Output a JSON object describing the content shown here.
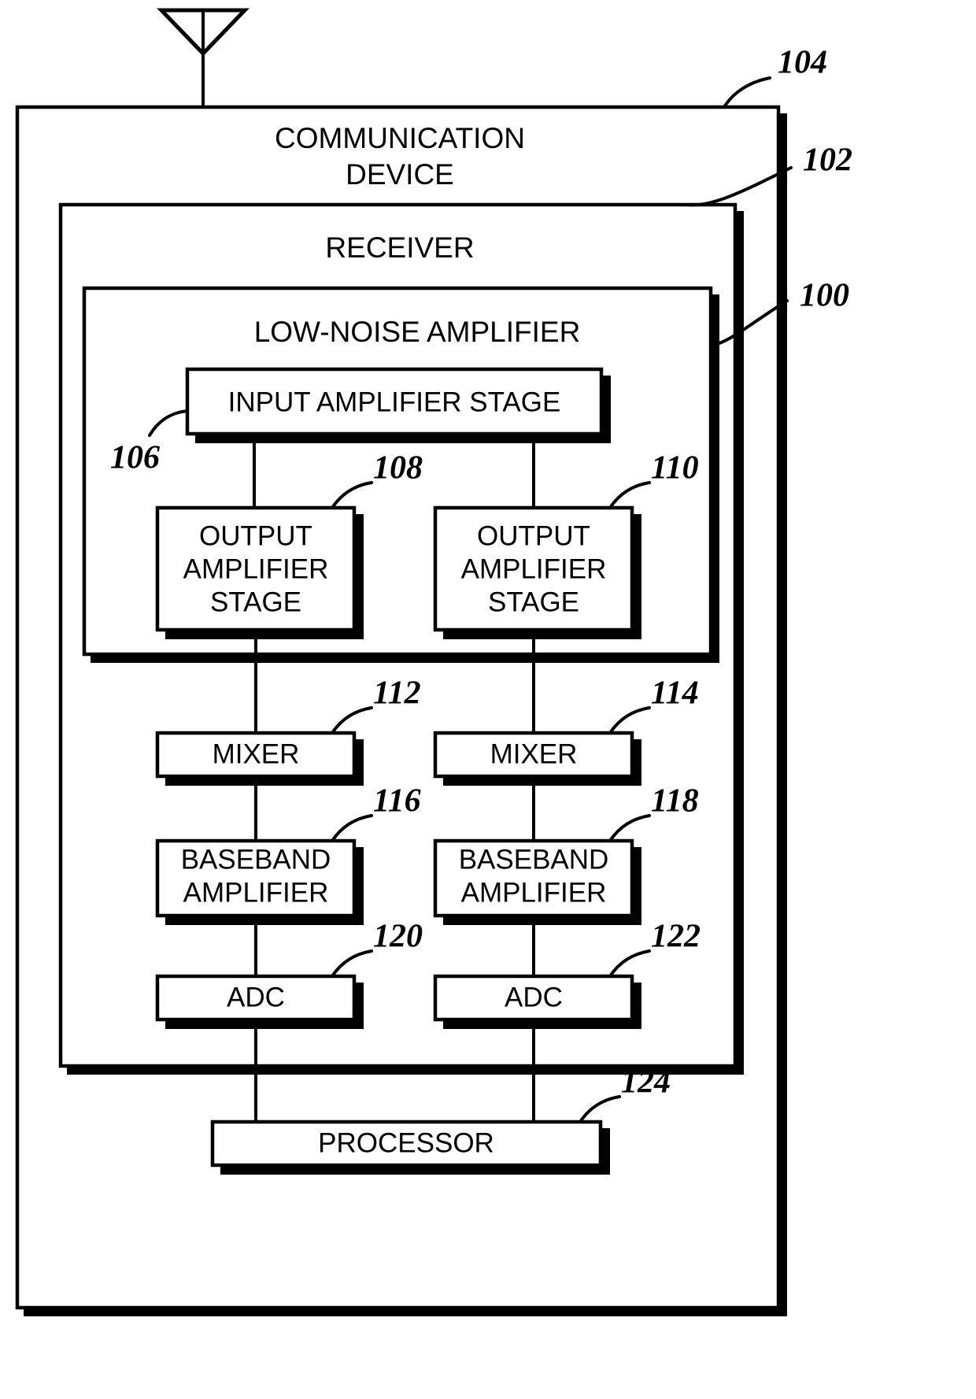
{
  "figure": {
    "title": "Communication device receiver block diagram",
    "background_color": "#ffffff",
    "line_color": "#000000"
  },
  "antenna": {
    "name": "antenna-symbol"
  },
  "containers": [
    {
      "id": "communication-device",
      "label": "COMMUNICATION DEVICE",
      "label_line_1": "COMMUNICATION",
      "label_line_2": "DEVICE",
      "ref": "104"
    },
    {
      "id": "receiver",
      "label": "RECEIVER",
      "ref": "102"
    },
    {
      "id": "low-noise-amplifier",
      "label": "LOW-NOISE AMPLIFIER",
      "ref": "100"
    }
  ],
  "blocks": [
    {
      "id": "input-amplifier-stage",
      "label": "INPUT AMPLIFIER STAGE",
      "lines": [
        "INPUT AMPLIFIER STAGE"
      ],
      "ref": "106"
    },
    {
      "id": "output-amplifier-stage-left",
      "label": "OUTPUT AMPLIFIER STAGE",
      "lines": [
        "OUTPUT",
        "AMPLIFIER",
        "STAGE"
      ],
      "ref": "108"
    },
    {
      "id": "output-amplifier-stage-right",
      "label": "OUTPUT AMPLIFIER STAGE",
      "lines": [
        "OUTPUT",
        "AMPLIFIER",
        "STAGE"
      ],
      "ref": "110"
    },
    {
      "id": "mixer-left",
      "label": "MIXER",
      "lines": [
        "MIXER"
      ],
      "ref": "112"
    },
    {
      "id": "mixer-right",
      "label": "MIXER",
      "lines": [
        "MIXER"
      ],
      "ref": "114"
    },
    {
      "id": "baseband-amplifier-left",
      "label": "BASEBAND AMPLIFIER",
      "lines": [
        "BASEBAND",
        "AMPLIFIER"
      ],
      "ref": "116"
    },
    {
      "id": "baseband-amplifier-right",
      "label": "BASEBAND AMPLIFIER",
      "lines": [
        "BASEBAND",
        "AMPLIFIER"
      ],
      "ref": "118"
    },
    {
      "id": "adc-left",
      "label": "ADC",
      "lines": [
        "ADC"
      ],
      "ref": "120"
    },
    {
      "id": "adc-right",
      "label": "ADC",
      "lines": [
        "ADC"
      ],
      "ref": "122"
    },
    {
      "id": "processor",
      "label": "PROCESSOR",
      "lines": [
        "PROCESSOR"
      ],
      "ref": "124"
    }
  ],
  "switches": [
    {
      "id": "switch-left",
      "state": "open"
    },
    {
      "id": "switch-right",
      "state": "open"
    }
  ],
  "reference_numerals": {
    "communication_device": "104",
    "receiver": "102",
    "low_noise_amplifier": "100",
    "input_amplifier_stage": "106",
    "output_amplifier_stage_left": "108",
    "output_amplifier_stage_right": "110",
    "mixer_left": "112",
    "mixer_right": "114",
    "baseband_amplifier_left": "116",
    "baseband_amplifier_right": "118",
    "adc_left": "120",
    "adc_right": "122",
    "processor": "124"
  },
  "text": {
    "communication_device_line1": "COMMUNICATION",
    "communication_device_line2": "DEVICE",
    "receiver": "RECEIVER",
    "low_noise_amplifier": "LOW-NOISE AMPLIFIER",
    "input_amplifier_stage": "INPUT AMPLIFIER STAGE",
    "output_l_1": "OUTPUT",
    "output_l_2": "AMPLIFIER",
    "output_l_3": "STAGE",
    "output_r_1": "OUTPUT",
    "output_r_2": "AMPLIFIER",
    "output_r_3": "STAGE",
    "mixer_l": "MIXER",
    "mixer_r": "MIXER",
    "baseband_l_1": "BASEBAND",
    "baseband_l_2": "AMPLIFIER",
    "baseband_r_1": "BASEBAND",
    "baseband_r_2": "AMPLIFIER",
    "adc_l": "ADC",
    "adc_r": "ADC",
    "processor": "PROCESSOR"
  }
}
